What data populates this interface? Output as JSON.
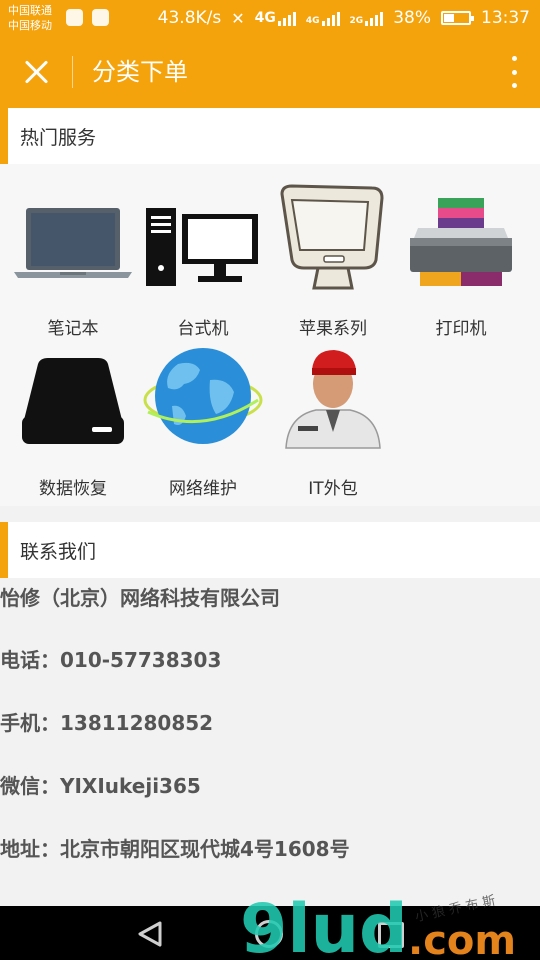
{
  "status_bar": {
    "carrier1": "中国联通",
    "carrier2": "中国移动",
    "speed": "43.8K/s",
    "net_4g": "4G",
    "net_4g_small": "4G",
    "net_2g": "2G",
    "battery_percent": "38%",
    "time": "13:37",
    "battery_level": 0.38
  },
  "app_bar": {
    "title": "分类下单",
    "close_icon": "close-icon",
    "more_icon": "more-vert-icon"
  },
  "hot_services": {
    "heading": "热门服务",
    "items": [
      {
        "label": "笔记本",
        "icon": "laptop-icon"
      },
      {
        "label": "台式机",
        "icon": "desktop-computer-icon"
      },
      {
        "label": "苹果系列",
        "icon": "imac-icon"
      },
      {
        "label": "打印机",
        "icon": "printer-icon"
      },
      {
        "label": "数据恢复",
        "icon": "hard-drive-icon"
      },
      {
        "label": "网络维护",
        "icon": "globe-network-icon"
      },
      {
        "label": "IT外包",
        "icon": "technician-icon"
      }
    ]
  },
  "contact": {
    "heading": "联系我们",
    "company": "怡修（北京）网络科技有限公司",
    "phone": "电话：010-57738303",
    "mobile": "手机：13811280852",
    "wechat": "微信：YIXIukeji365",
    "address": "地址：北京市朝阳区现代城4号1608号"
  },
  "nav_bar": {
    "back_icon": "back-triangle-icon",
    "home_icon": "home-circle-icon",
    "recent_icon": "recent-apps-square-icon"
  },
  "watermark": {
    "brand": "9lud",
    "domain": ".com",
    "tagline": "小 狼 乔 布 斯"
  },
  "colors": {
    "accent": "#f5a30c",
    "background": "#f2f2f2",
    "navbar": "#000000"
  }
}
